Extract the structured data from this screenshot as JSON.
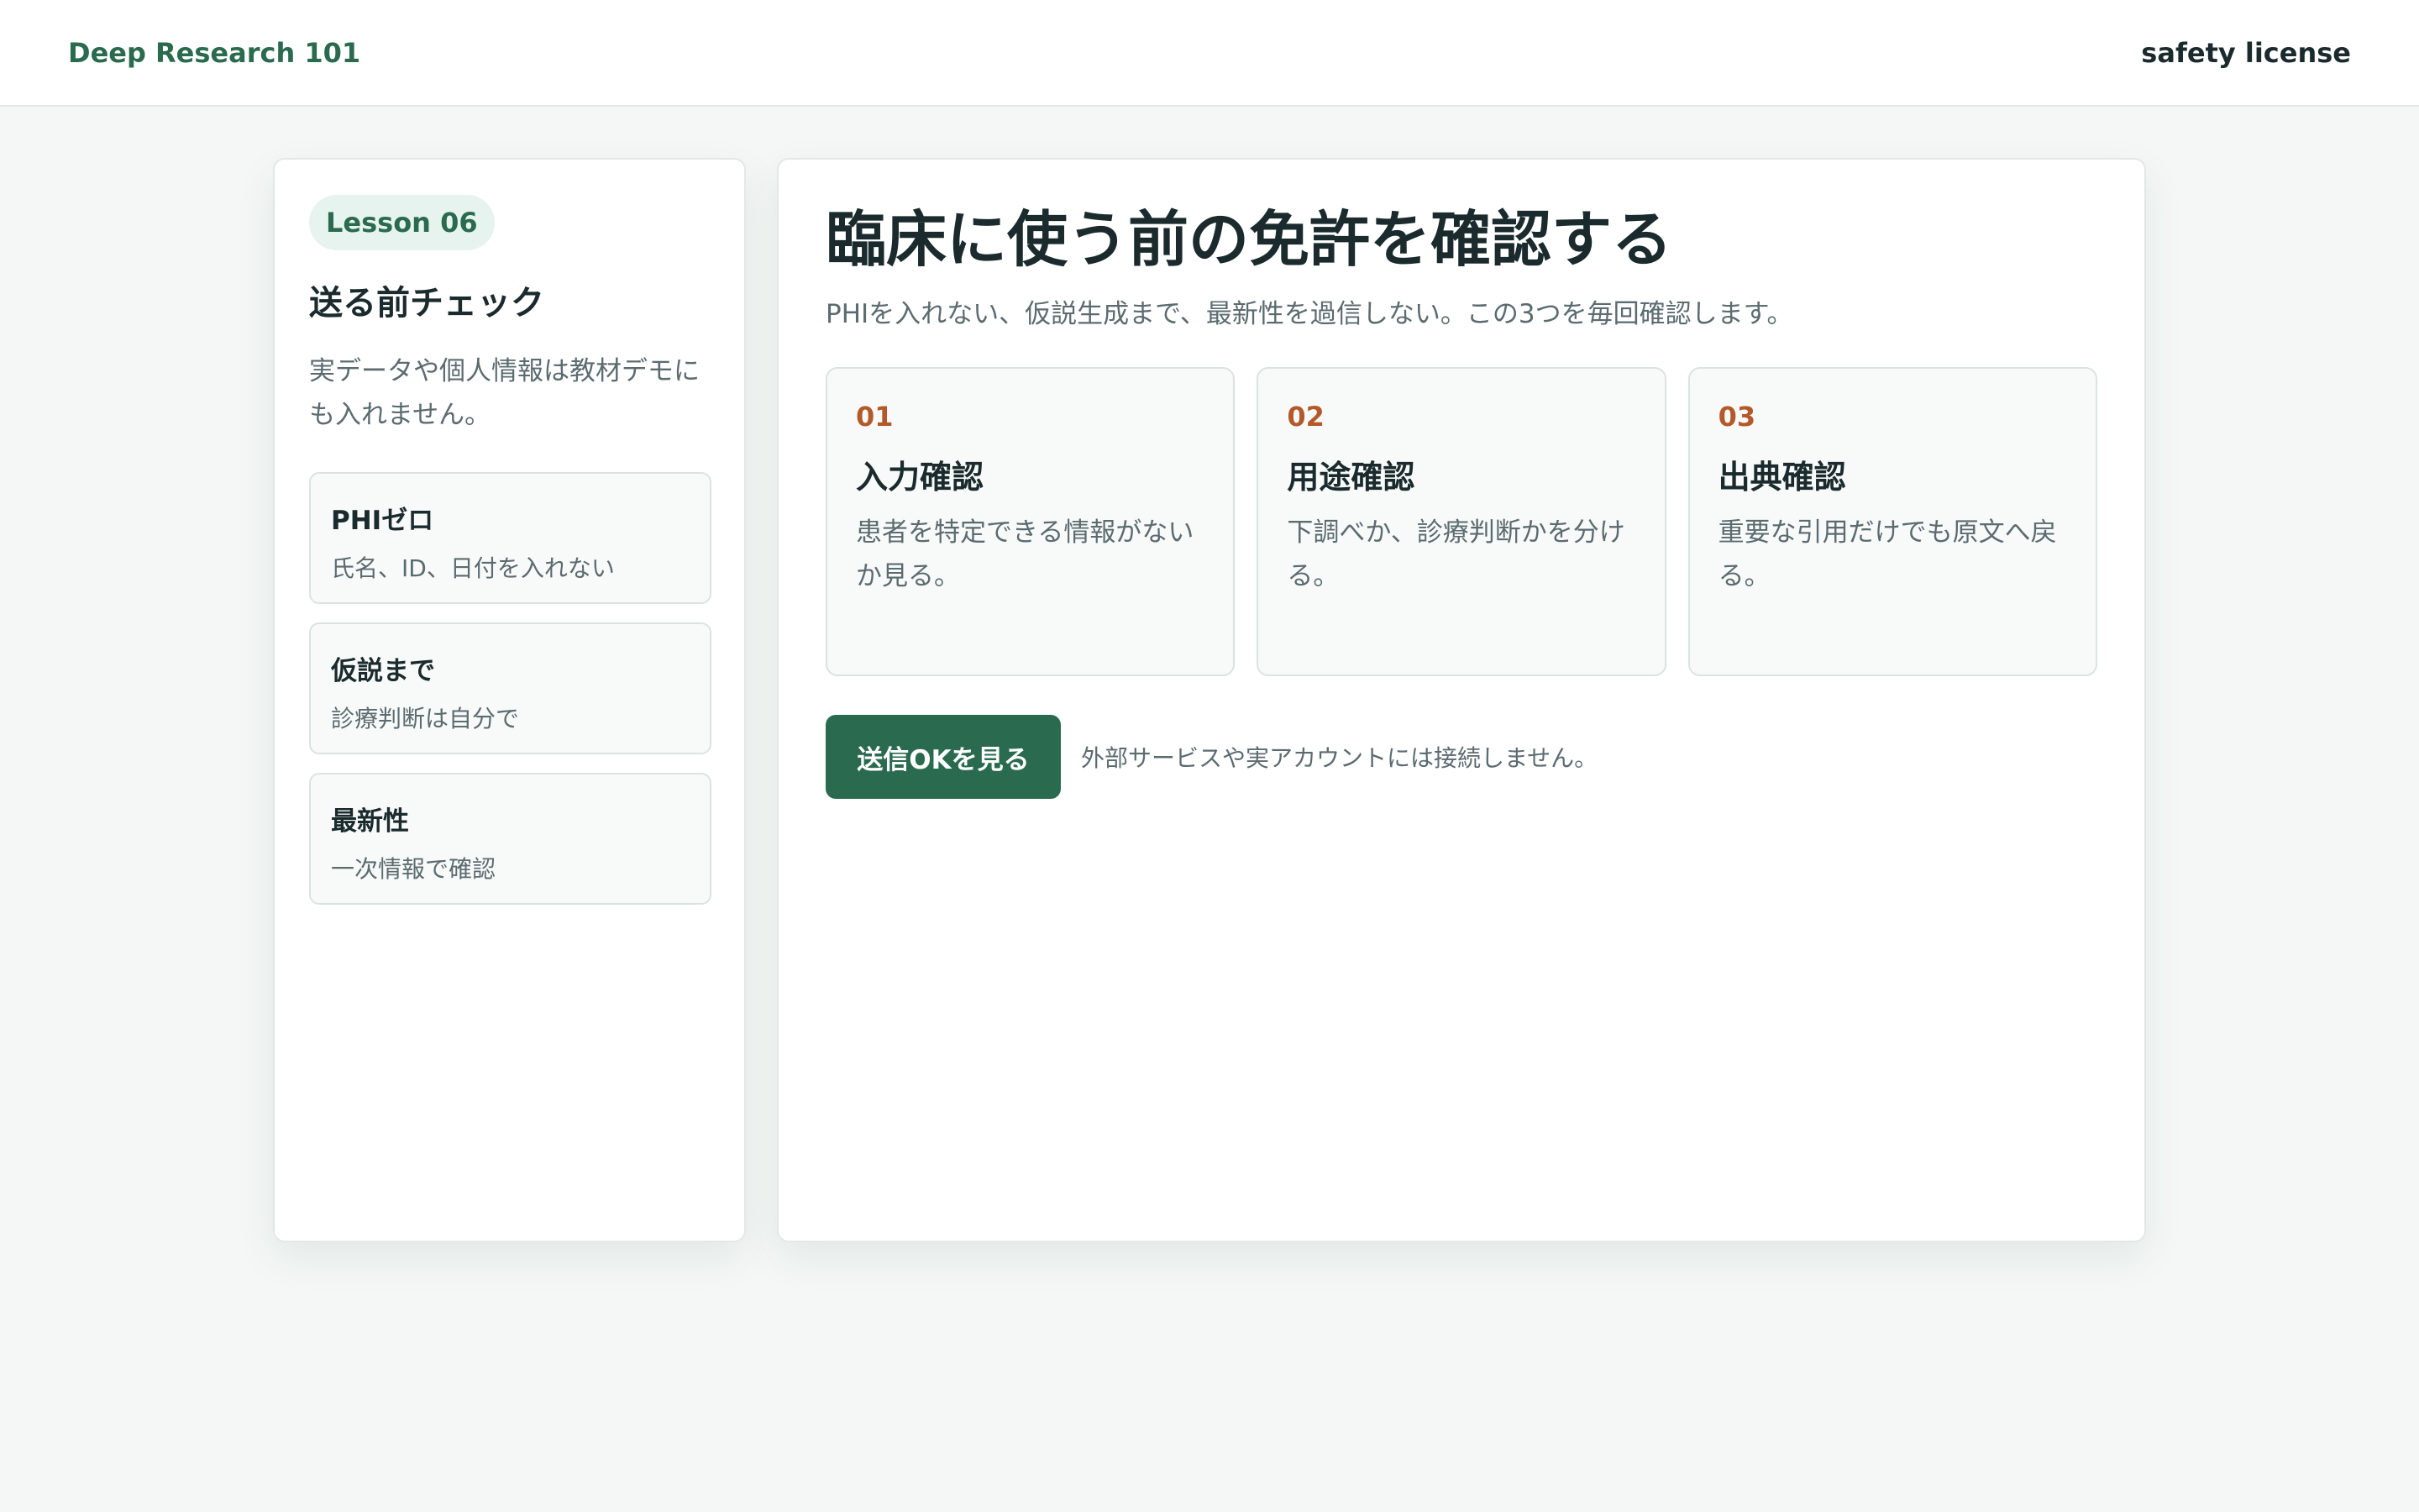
{
  "header": {
    "brand": "Deep Research 101",
    "mode": "safety license"
  },
  "sidebar": {
    "badge": "Lesson 06",
    "title": "送る前チェック",
    "description": "実データや個人情報は教材デモにも入れません。",
    "items": [
      {
        "title": "PHIゼロ",
        "sub": "氏名、ID、日付を入れない"
      },
      {
        "title": "仮説まで",
        "sub": "診療判断は自分で"
      },
      {
        "title": "最新性",
        "sub": "一次情報で確認"
      }
    ]
  },
  "main": {
    "title": "臨床に使う前の免許を確認する",
    "subtitle": "PHIを入れない、仮説生成まで、最新性を過信しない。この3つを毎回確認します。",
    "steps": [
      {
        "num": "01",
        "title": "入力確認",
        "desc": "患者を特定できる情報がないか見る。"
      },
      {
        "num": "02",
        "title": "用途確認",
        "desc": "下調べか、診療判断かを分ける。"
      },
      {
        "num": "03",
        "title": "出典確認",
        "desc": "重要な引用だけでも原文へ戻る。"
      }
    ],
    "button_label": "送信OKを見る",
    "note": "外部サービスや実アカウントには接続しません。"
  },
  "colors": {
    "accent": "#2a6a4e",
    "step_number": "#b35a2a",
    "background": "#f4f7f6"
  }
}
